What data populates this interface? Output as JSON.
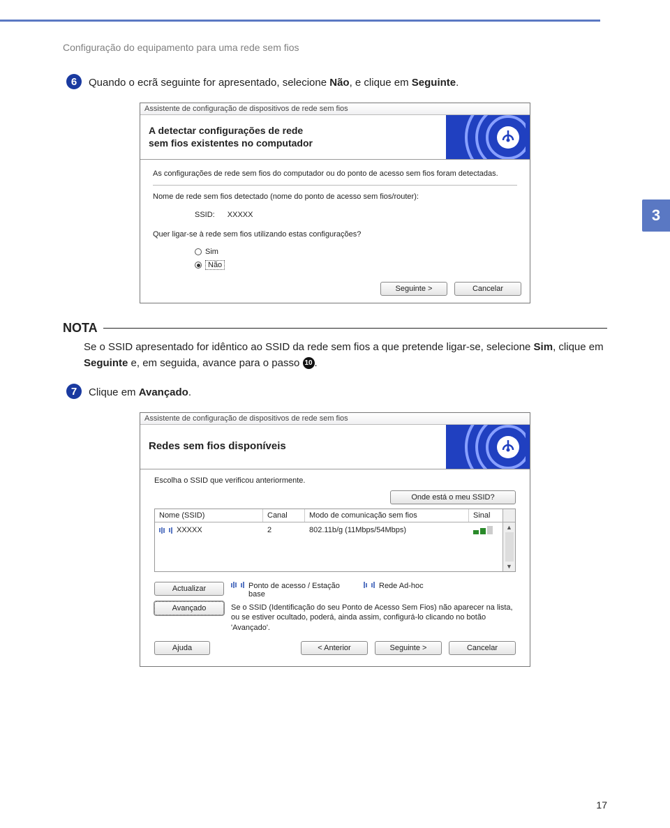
{
  "header": "Configuração do equipamento para uma rede sem fios",
  "side_chapter": "3",
  "page_number": "17",
  "step6": {
    "num": "6",
    "text_before": "Quando o ecrã seguinte for apresentado, selecione ",
    "nao": "Não",
    "mid": ", e clique em ",
    "seguinte": "Seguinte",
    "end": "."
  },
  "dlg1": {
    "titlebar": "Assistente de configuração de dispositivos de rede sem fios",
    "title_l1": "A detectar configurações de rede",
    "title_l2": "sem fios existentes no computador",
    "intro": "As configurações de rede sem fios do computador ou do ponto de acesso sem fios foram detectadas.",
    "detected_label": "Nome de rede sem fios detectado (nome do ponto de acesso sem fios/router):",
    "ssid_label": "SSID:",
    "ssid_value": "XXXXX",
    "question": "Quer ligar-se à rede sem fios utilizando estas configurações?",
    "opt_sim": "Sim",
    "opt_nao": "Não",
    "btn_next": "Seguinte >",
    "btn_cancel": "Cancelar"
  },
  "nota": {
    "title": "NOTA",
    "t1": "Se o SSID apresentado for idêntico ao SSID da rede sem fios a que pretende ligar-se, selecione ",
    "sim": "Sim",
    "t2": ", clique em ",
    "seguinte": "Seguinte",
    "t3": " e, em seguida, avance para o passo ",
    "ref": "10",
    "t4": "."
  },
  "step7": {
    "num": "7",
    "text": "Clique em ",
    "avancado": "Avançado",
    "end": "."
  },
  "dlg2": {
    "titlebar": "Assistente de configuração de dispositivos de rede sem fios",
    "title": "Redes sem fios disponíveis",
    "intro": "Escolha o SSID que verificou anteriormente.",
    "where_btn": "Onde está o meu SSID?",
    "cols": {
      "ssid": "Nome (SSID)",
      "canal": "Canal",
      "modo": "Modo de comunicação sem fios",
      "sinal": "Sinal"
    },
    "row": {
      "ssid": "XXXXX",
      "canal": "2",
      "modo": "802.11b/g (11Mbps/54Mbps)"
    },
    "btn_update": "Actualizar",
    "btn_adv": "Avançado",
    "legend_ap": "Ponto de acesso / Estação base",
    "legend_adhoc": "Rede Ad-hoc",
    "hint": "Se o SSID (Identificação do seu Ponto de Acesso Sem Fios) não aparecer na lista, ou se estiver ocultado, poderá, ainda assim, configurá-lo clicando no botão 'Avançado'.",
    "btn_help": "Ajuda",
    "btn_prev": "< Anterior",
    "btn_next": "Seguinte >",
    "btn_cancel": "Cancelar"
  }
}
